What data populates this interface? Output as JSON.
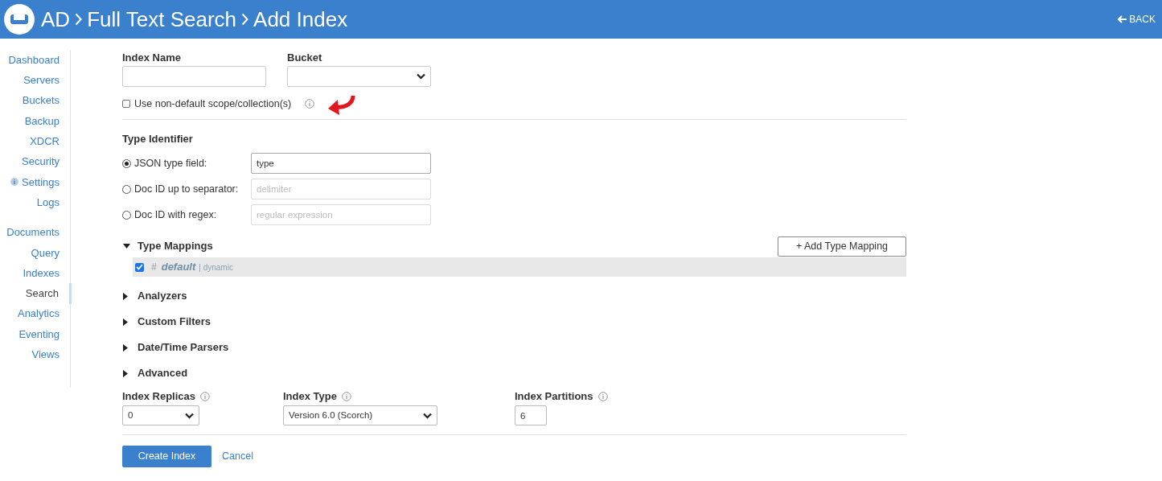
{
  "header": {
    "breadcrumb": [
      "AD",
      "Full Text Search",
      "Add Index"
    ],
    "back": "BACK"
  },
  "sidebar": {
    "groups": [
      [
        {
          "label": "Dashboard",
          "selected": false
        },
        {
          "label": "Servers",
          "selected": false
        },
        {
          "label": "Buckets",
          "selected": false
        },
        {
          "label": "Backup",
          "selected": false
        },
        {
          "label": "XDCR",
          "selected": false
        },
        {
          "label": "Security",
          "selected": false
        },
        {
          "label": "Settings",
          "selected": false,
          "info": true
        },
        {
          "label": "Logs",
          "selected": false
        }
      ],
      [
        {
          "label": "Documents",
          "selected": false
        },
        {
          "label": "Query",
          "selected": false
        },
        {
          "label": "Indexes",
          "selected": false
        },
        {
          "label": "Search",
          "selected": true
        },
        {
          "label": "Analytics",
          "selected": false
        },
        {
          "label": "Eventing",
          "selected": false
        },
        {
          "label": "Views",
          "selected": false
        }
      ]
    ]
  },
  "form": {
    "index_name": {
      "label": "Index Name"
    },
    "bucket": {
      "label": "Bucket"
    },
    "scope_checkbox": {
      "label": "Use non-default scope/collection(s)",
      "checked": false
    },
    "type_identifier": {
      "title": "Type Identifier",
      "options": [
        {
          "label": "JSON type field:",
          "selected": true,
          "value": "type"
        },
        {
          "label": "Doc ID up to separator:",
          "selected": false,
          "placeholder": "delimiter"
        },
        {
          "label": "Doc ID with regex:",
          "selected": false,
          "placeholder": "regular expression"
        }
      ]
    },
    "sections": [
      {
        "title": "Type Mappings",
        "expanded": true,
        "button": "+ Add Type Mapping",
        "mappings": [
          {
            "hash": "#",
            "name": "default",
            "mode": "| dynamic",
            "checked": true
          }
        ]
      },
      {
        "title": "Analyzers",
        "expanded": false
      },
      {
        "title": "Custom Filters",
        "expanded": false
      },
      {
        "title": "Date/Time Parsers",
        "expanded": false
      },
      {
        "title": "Advanced",
        "expanded": false
      }
    ],
    "settings": [
      {
        "kind": "select",
        "label": "Index Replicas",
        "value": "0"
      },
      {
        "kind": "select",
        "label": "Index Type",
        "value": "Version 6.0 (Scorch)"
      },
      {
        "kind": "input",
        "label": "Index Partitions",
        "value": "6"
      }
    ],
    "actions": {
      "primary": "Create Index",
      "cancel": "Cancel"
    }
  }
}
